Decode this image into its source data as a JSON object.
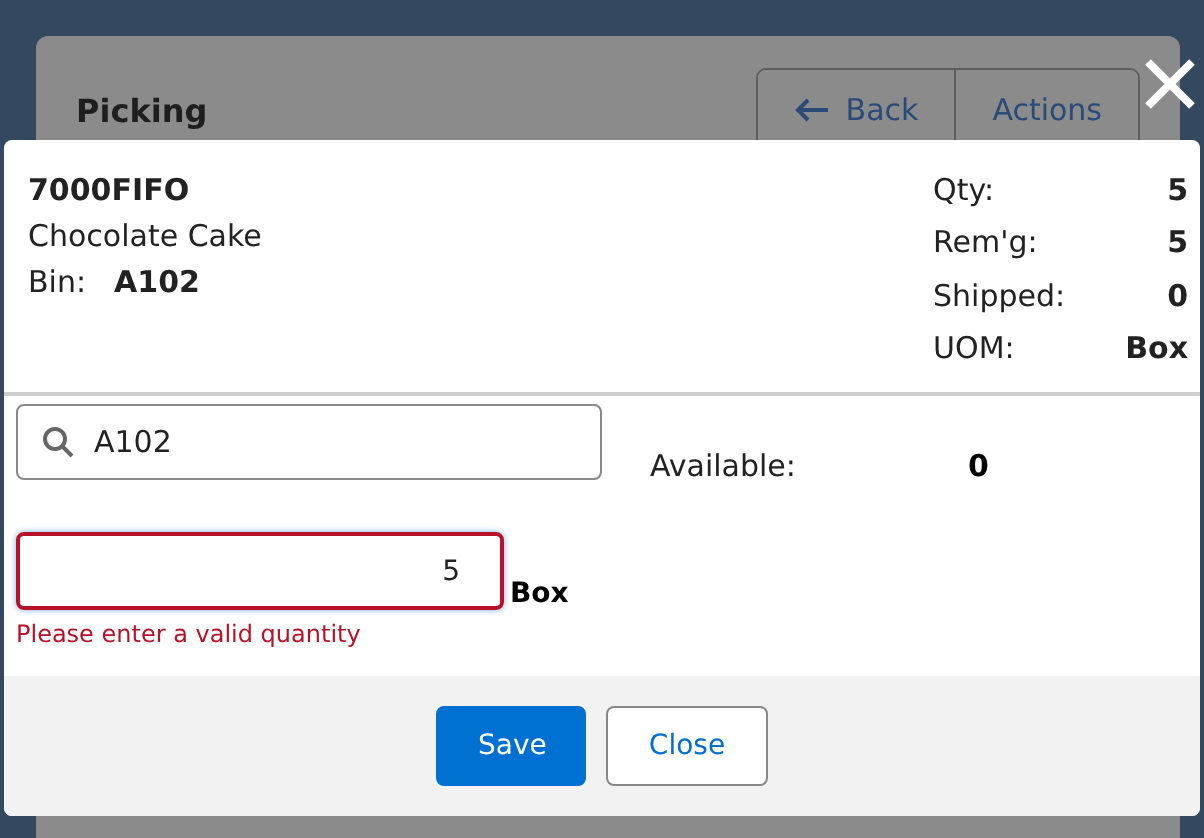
{
  "page": {
    "title": "Picking",
    "back_button": "Back",
    "actions_button": "Actions"
  },
  "dialog": {
    "item_code": "7000FIFO",
    "description": "Chocolate Cake",
    "bin_label": "Bin:",
    "bin_value": "A102",
    "summary": [
      {
        "label": "Qty:",
        "value": "5"
      },
      {
        "label": "Rem'g:",
        "value": "5"
      },
      {
        "label": "Shipped:",
        "value": "0"
      },
      {
        "label": "UOM:",
        "value": "Box"
      }
    ],
    "bin_search": {
      "value": "A102"
    },
    "available": {
      "label": "Available:",
      "value": "0"
    },
    "quantity": {
      "value": "5",
      "unit": "Box",
      "invalid": true
    },
    "error": "Please enter a valid quantity",
    "buttons": [
      {
        "label": "Save",
        "kind": "primary"
      },
      {
        "label": "Close",
        "kind": "secondary"
      }
    ]
  }
}
